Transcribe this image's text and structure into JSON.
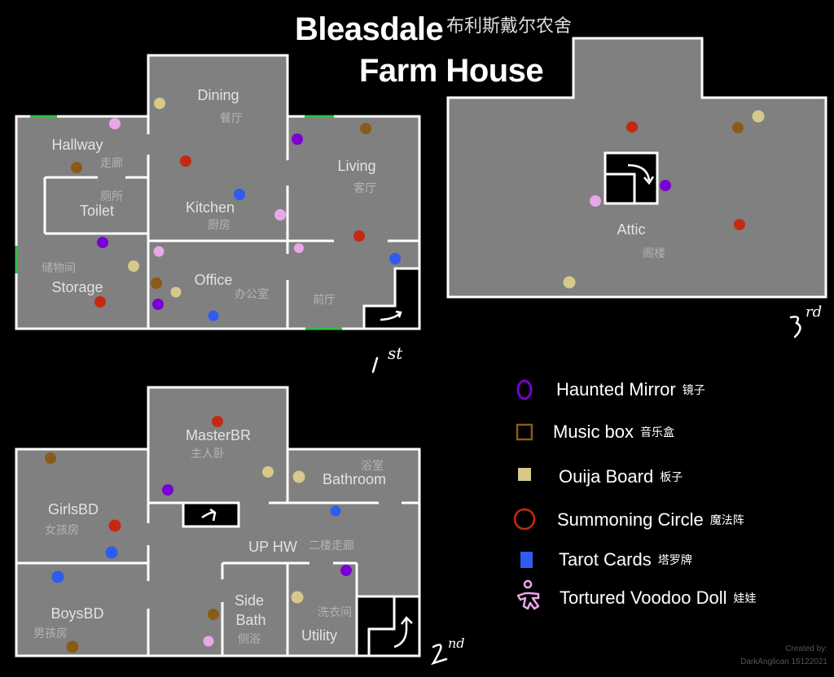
{
  "title": {
    "line1": "Bleasdale",
    "line2": "Farm House",
    "chinese": "布利斯戴尔农舍"
  },
  "colors": {
    "background": "#000000",
    "floor": "#808080",
    "wall": "#ffffff",
    "door_green": "#2fbf3f",
    "room_label": "#e2e2e2",
    "room_label_cn": "#b4b4b4",
    "haunted_mirror": "#7a00d4",
    "music_box": "#8a5a18",
    "ouija_board": "#d6c98a",
    "summoning_circle": "#c42a12",
    "tarot_cards": "#2f5bf0",
    "voodoo_doll": "#e8a8e8"
  },
  "floors": [
    {
      "id": "1st",
      "tag_main": "1",
      "tag_sup": "st",
      "rooms": [
        {
          "name": "Dining",
          "cn": "餐厅"
        },
        {
          "name": "Hallway",
          "cn": "走廊"
        },
        {
          "name": "Toilet",
          "cn": "厕所"
        },
        {
          "name": "Kitchen",
          "cn": "厨房"
        },
        {
          "name": "Living",
          "cn": "客厅"
        },
        {
          "name": "Storage",
          "cn": "储物间"
        },
        {
          "name": "Office",
          "cn": "办公室"
        },
        {
          "name": "",
          "cn": "前厅"
        }
      ]
    },
    {
      "id": "2nd",
      "tag_main": "2",
      "tag_sup": "nd",
      "rooms": [
        {
          "name": "MasterBR",
          "cn": "主人卧"
        },
        {
          "name": "GirlsBD",
          "cn": "女孩房"
        },
        {
          "name": "Bathroom",
          "cn": "浴室"
        },
        {
          "name": "UP HW",
          "cn": "二楼走廊"
        },
        {
          "name": "BoysBD",
          "cn": "男孩房"
        },
        {
          "name": "Side Bath",
          "cn": "侧浴"
        },
        {
          "name": "Utility",
          "cn": "洗衣间"
        }
      ]
    },
    {
      "id": "3rd",
      "tag_main": "3",
      "tag_sup": "rd",
      "rooms": [
        {
          "name": "Attic",
          "cn": "阁楼"
        }
      ]
    }
  ],
  "legend": [
    {
      "key": "haunted_mirror",
      "label": "Haunted Mirror",
      "cn": "镜子",
      "icon": "mirror-ring-icon"
    },
    {
      "key": "music_box",
      "label": "Music box",
      "cn": "音乐盒",
      "icon": "music-box-square-icon"
    },
    {
      "key": "ouija_board",
      "label": "Ouija Board",
      "cn": "板子",
      "icon": "ouija-board-square-icon"
    },
    {
      "key": "summoning_circle",
      "label": "Summoning Circle",
      "cn": "魔法阵",
      "icon": "summoning-circle-ring-icon"
    },
    {
      "key": "tarot_cards",
      "label": "Tarot Cards",
      "cn": "塔罗牌",
      "icon": "tarot-card-icon"
    },
    {
      "key": "voodoo_doll",
      "label": "Tortured Voodoo Doll",
      "cn": "娃娃",
      "icon": "voodoo-doll-icon"
    }
  ],
  "markers_by_room": {
    "Dining": [
      "ouija_board"
    ],
    "Hallway": [
      "voodoo_doll",
      "music_box"
    ],
    "Kitchen": [
      "summoning_circle",
      "tarot_cards",
      "voodoo_doll"
    ],
    "Living": [
      "haunted_mirror",
      "music_box",
      "summoning_circle"
    ],
    "Storage": [
      "haunted_mirror",
      "ouija_board",
      "summoning_circle"
    ],
    "Office": [
      "voodoo_doll",
      "music_box",
      "ouija_board",
      "haunted_mirror",
      "tarot_cards"
    ],
    "前厅": [
      "voodoo_doll",
      "tarot_cards"
    ],
    "Attic": [
      "summoning_circle",
      "music_box",
      "ouija_board",
      "haunted_mirror",
      "voodoo_doll",
      "summoning_circle",
      "ouija_board"
    ],
    "MasterBR": [
      "summoning_circle",
      "ouija_board",
      "haunted_mirror"
    ],
    "GirlsBD": [
      "music_box",
      "summoning_circle",
      "tarot_cards"
    ],
    "Bathroom": [
      "ouija_board"
    ],
    "UP HW": [
      "tarot_cards",
      "haunted_mirror",
      "music_box",
      "voodoo_doll"
    ],
    "BoysBD": [
      "tarot_cards",
      "music_box"
    ],
    "Utility": [
      "ouija_board"
    ]
  },
  "credit": {
    "line1": "Created by:",
    "line2": "DarkAnglican 15122021"
  }
}
